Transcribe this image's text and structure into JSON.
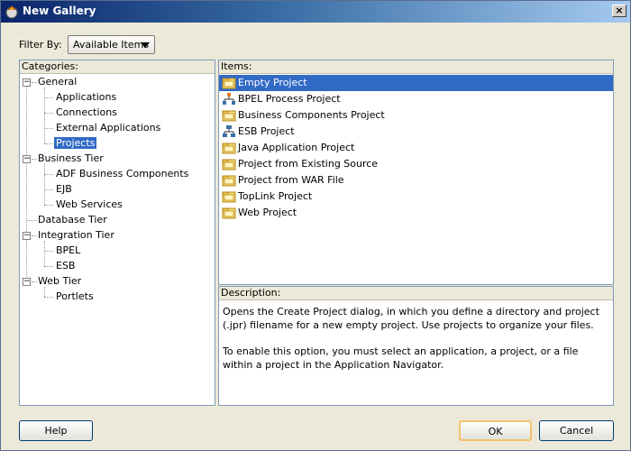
{
  "window": {
    "title": "New Gallery",
    "close": "×"
  },
  "filter": {
    "label": "Filter By:",
    "value": "Available Items"
  },
  "categories": {
    "header": "Categories:",
    "nodes": {
      "general": "General",
      "applications": "Applications",
      "connections": "Connections",
      "external_applications": "External Applications",
      "projects": "Projects",
      "business_tier": "Business Tier",
      "adf_business_components": "ADF Business Components",
      "ejb": "EJB",
      "web_services": "Web Services",
      "database_tier": "Database Tier",
      "integration_tier": "Integration Tier",
      "bpel": "BPEL",
      "esb": "ESB",
      "web_tier": "Web Tier",
      "portlets": "Portlets"
    },
    "expander_minus": "−"
  },
  "items": {
    "header": "Items:",
    "list": [
      {
        "label": "Empty Project",
        "icon": "folder-icon"
      },
      {
        "label": "BPEL Process Project",
        "icon": "bpel-process-icon"
      },
      {
        "label": "Business Components Project",
        "icon": "folder-icon"
      },
      {
        "label": "ESB Project",
        "icon": "esb-icon"
      },
      {
        "label": "Java Application Project",
        "icon": "folder-icon"
      },
      {
        "label": "Project from Existing Source",
        "icon": "folder-icon"
      },
      {
        "label": "Project from WAR File",
        "icon": "folder-icon"
      },
      {
        "label": "TopLink Project",
        "icon": "folder-icon"
      },
      {
        "label": "Web Project",
        "icon": "folder-icon"
      }
    ],
    "selected_index": 0
  },
  "description": {
    "header": "Description:",
    "para1": "Opens the Create Project dialog, in which you define a directory and project (.jpr) filename for a new empty project. Use projects to organize your files.",
    "para2": "To enable this option, you must select an application, a project, or a file within a project in the Application Navigator."
  },
  "buttons": {
    "help": "Help",
    "ok": "OK",
    "cancel": "Cancel"
  },
  "colors": {
    "selection": "#316ac5",
    "titlebar": "#0a246a",
    "dialog_bg": "#ece9d8"
  }
}
